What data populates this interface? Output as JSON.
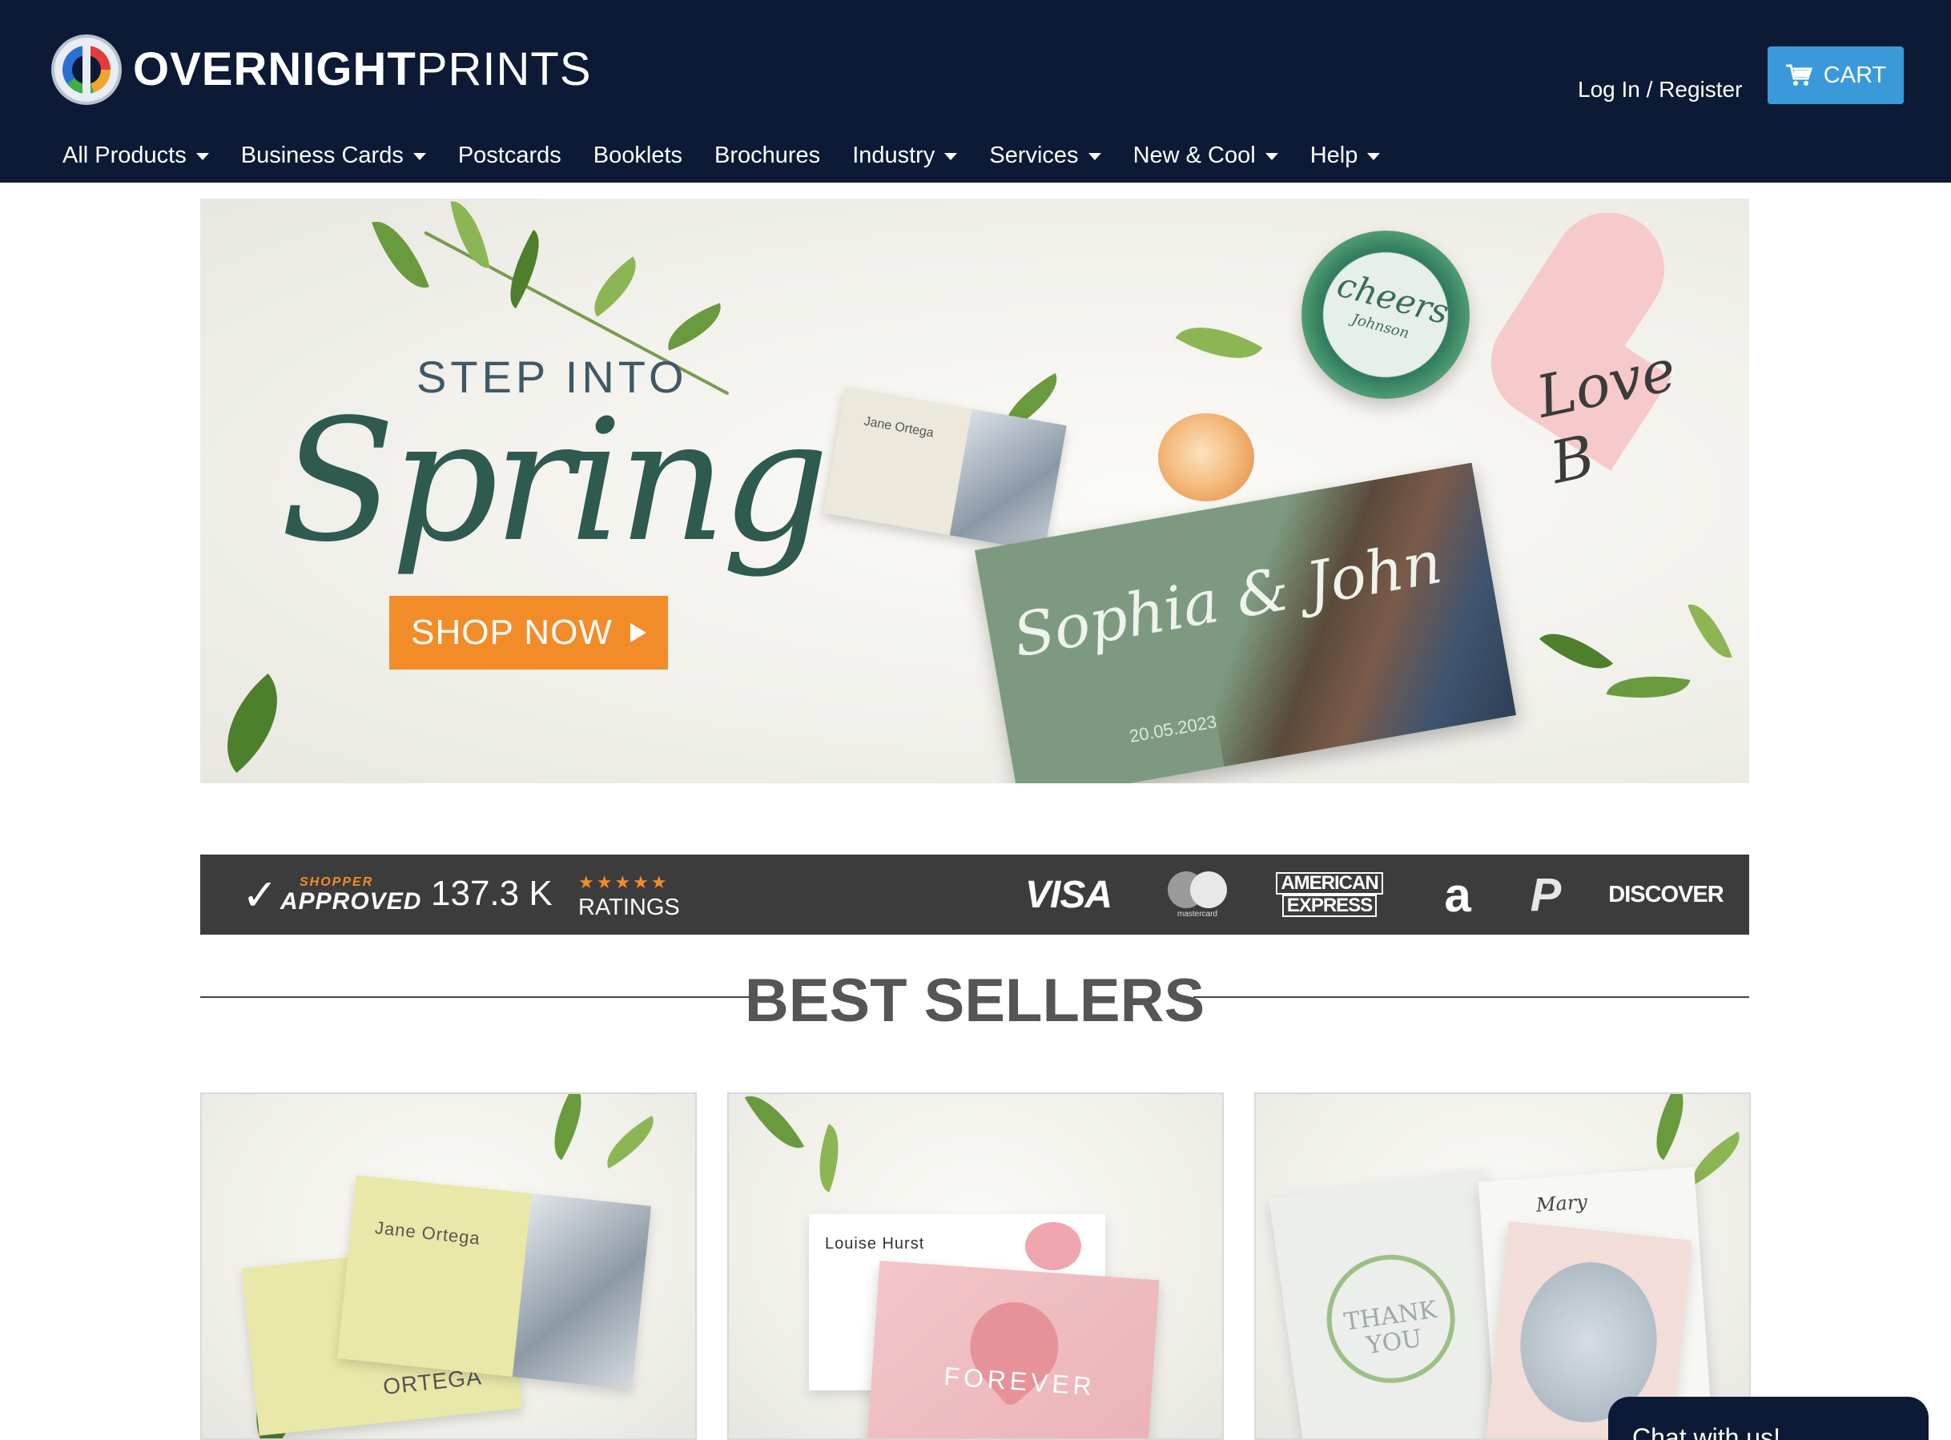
{
  "header": {
    "logo": {
      "bold": "OVERNIGHT",
      "light": "PRINTS"
    },
    "login_label": "Log In / Register",
    "cart_label": "CART",
    "nav": [
      {
        "label": "All Products",
        "dropdown": true
      },
      {
        "label": "Business Cards",
        "dropdown": true
      },
      {
        "label": "Postcards",
        "dropdown": false
      },
      {
        "label": "Booklets",
        "dropdown": false
      },
      {
        "label": "Brochures",
        "dropdown": false
      },
      {
        "label": "Industry",
        "dropdown": true
      },
      {
        "label": "Services",
        "dropdown": true
      },
      {
        "label": "New & Cool",
        "dropdown": true
      },
      {
        "label": "Help",
        "dropdown": true
      }
    ]
  },
  "hero": {
    "kicker": "STEP INTO",
    "headline": "Spring",
    "cta_label": "SHOP NOW",
    "business_card_name": "Jane Ortega",
    "invitation_names": "Sophia & John",
    "invitation_date": "20.05.2023",
    "cookie_text": "cheers",
    "cookie_subtext": "Johnson",
    "heart_text": "Love B"
  },
  "trust_bar": {
    "badge_top": "SHOPPER",
    "badge_main": "APPROVED",
    "rating_count": "137.3 K",
    "stars": "★★★★★",
    "ratings_label": "RATINGS",
    "payments": {
      "visa": "VISA",
      "mastercard": "mastercard",
      "amex_line1": "AMERICAN",
      "amex_line2": "EXPRESS",
      "amazon": "a",
      "paypal": "P",
      "discover": "DISCOVER"
    }
  },
  "best_sellers": {
    "title": "BEST SELLERS",
    "cards": [
      {
        "name_text": "Jane Ortega",
        "sub_text": "ORTEGA"
      },
      {
        "name_text": "Louise Hurst",
        "sub_text": "FOREVER"
      },
      {
        "name_text": "THANK YOU",
        "sub_text": "Mary"
      }
    ]
  },
  "chat": {
    "label": "Chat with us!"
  },
  "colors": {
    "header_bg": "#0c1a36",
    "cart_bg": "#3a9ad9",
    "cta_orange": "#f28c28",
    "trust_bg": "#3c3c3c"
  }
}
